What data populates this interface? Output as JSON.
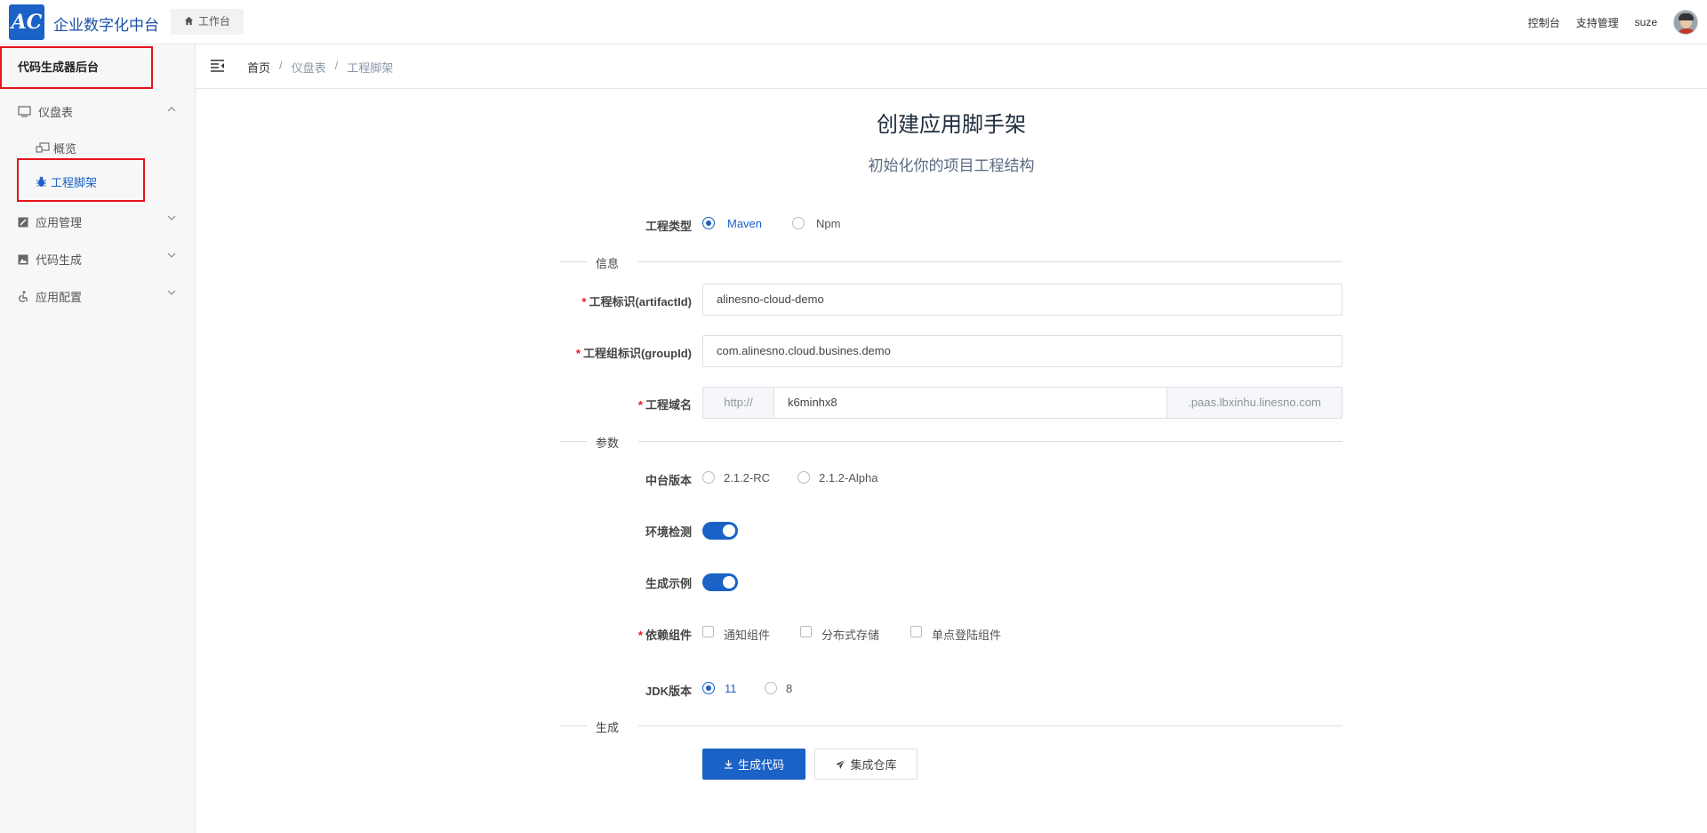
{
  "app": {
    "logo_text": "AC",
    "brand": "企业数字化中台",
    "home_tab": "工作台"
  },
  "topnav": {
    "console": "控制台",
    "support": "支持管理",
    "user": "suze"
  },
  "sidebar": {
    "title": "代码生成器后台",
    "items": [
      {
        "label": "仪盘表",
        "icon": "monitor-icon",
        "expanded": true
      },
      {
        "label": "应用管理",
        "icon": "app-icon"
      },
      {
        "label": "代码生成",
        "icon": "image-icon"
      },
      {
        "label": "应用配置",
        "icon": "accessibility-icon"
      }
    ],
    "sub_items": [
      {
        "label": "概览",
        "icon": "overview-icon"
      },
      {
        "label": "工程脚架",
        "icon": "bug-icon",
        "active": true
      }
    ]
  },
  "breadcrumb": [
    "首页",
    "仪盘表",
    "工程脚架"
  ],
  "page": {
    "title": "创建应用脚手架",
    "subtitle": "初始化你的项目工程结构"
  },
  "form": {
    "project_type": {
      "label": "工程类型",
      "options": [
        "Maven",
        "Npm"
      ],
      "selected": "Maven"
    },
    "section_info": "信息",
    "artifact_id": {
      "label": "工程标识(artifactId)",
      "value": "alinesno-cloud-demo",
      "required": true
    },
    "group_id": {
      "label": "工程组标识(groupId)",
      "value": "com.alinesno.cloud.busines.demo",
      "required": true
    },
    "domain": {
      "label": "工程域名",
      "prefix": "http://",
      "value": "k6minhx8",
      "suffix": ".paas.lbxinhu.linesno.com",
      "required": true
    },
    "section_params": "参数",
    "platform_version": {
      "label": "中台版本",
      "options": [
        "2.1.2-RC",
        "2.1.2-Alpha"
      ],
      "selected": null
    },
    "env_check": {
      "label": "环境检测",
      "on": true
    },
    "gen_example": {
      "label": "生成示例",
      "on": true
    },
    "dependencies": {
      "label": "依赖组件",
      "options": [
        "通知组件",
        "分布式存储",
        "单点登陆组件"
      ],
      "required": true
    },
    "jdk": {
      "label": "JDK版本",
      "options": [
        "11",
        "8"
      ],
      "selected": "11"
    },
    "section_generate": "生成",
    "btn_generate": "生成代码",
    "btn_repo": "集成仓库"
  },
  "colors": {
    "primary": "#1a62c6",
    "highlight": "#e5161d"
  }
}
